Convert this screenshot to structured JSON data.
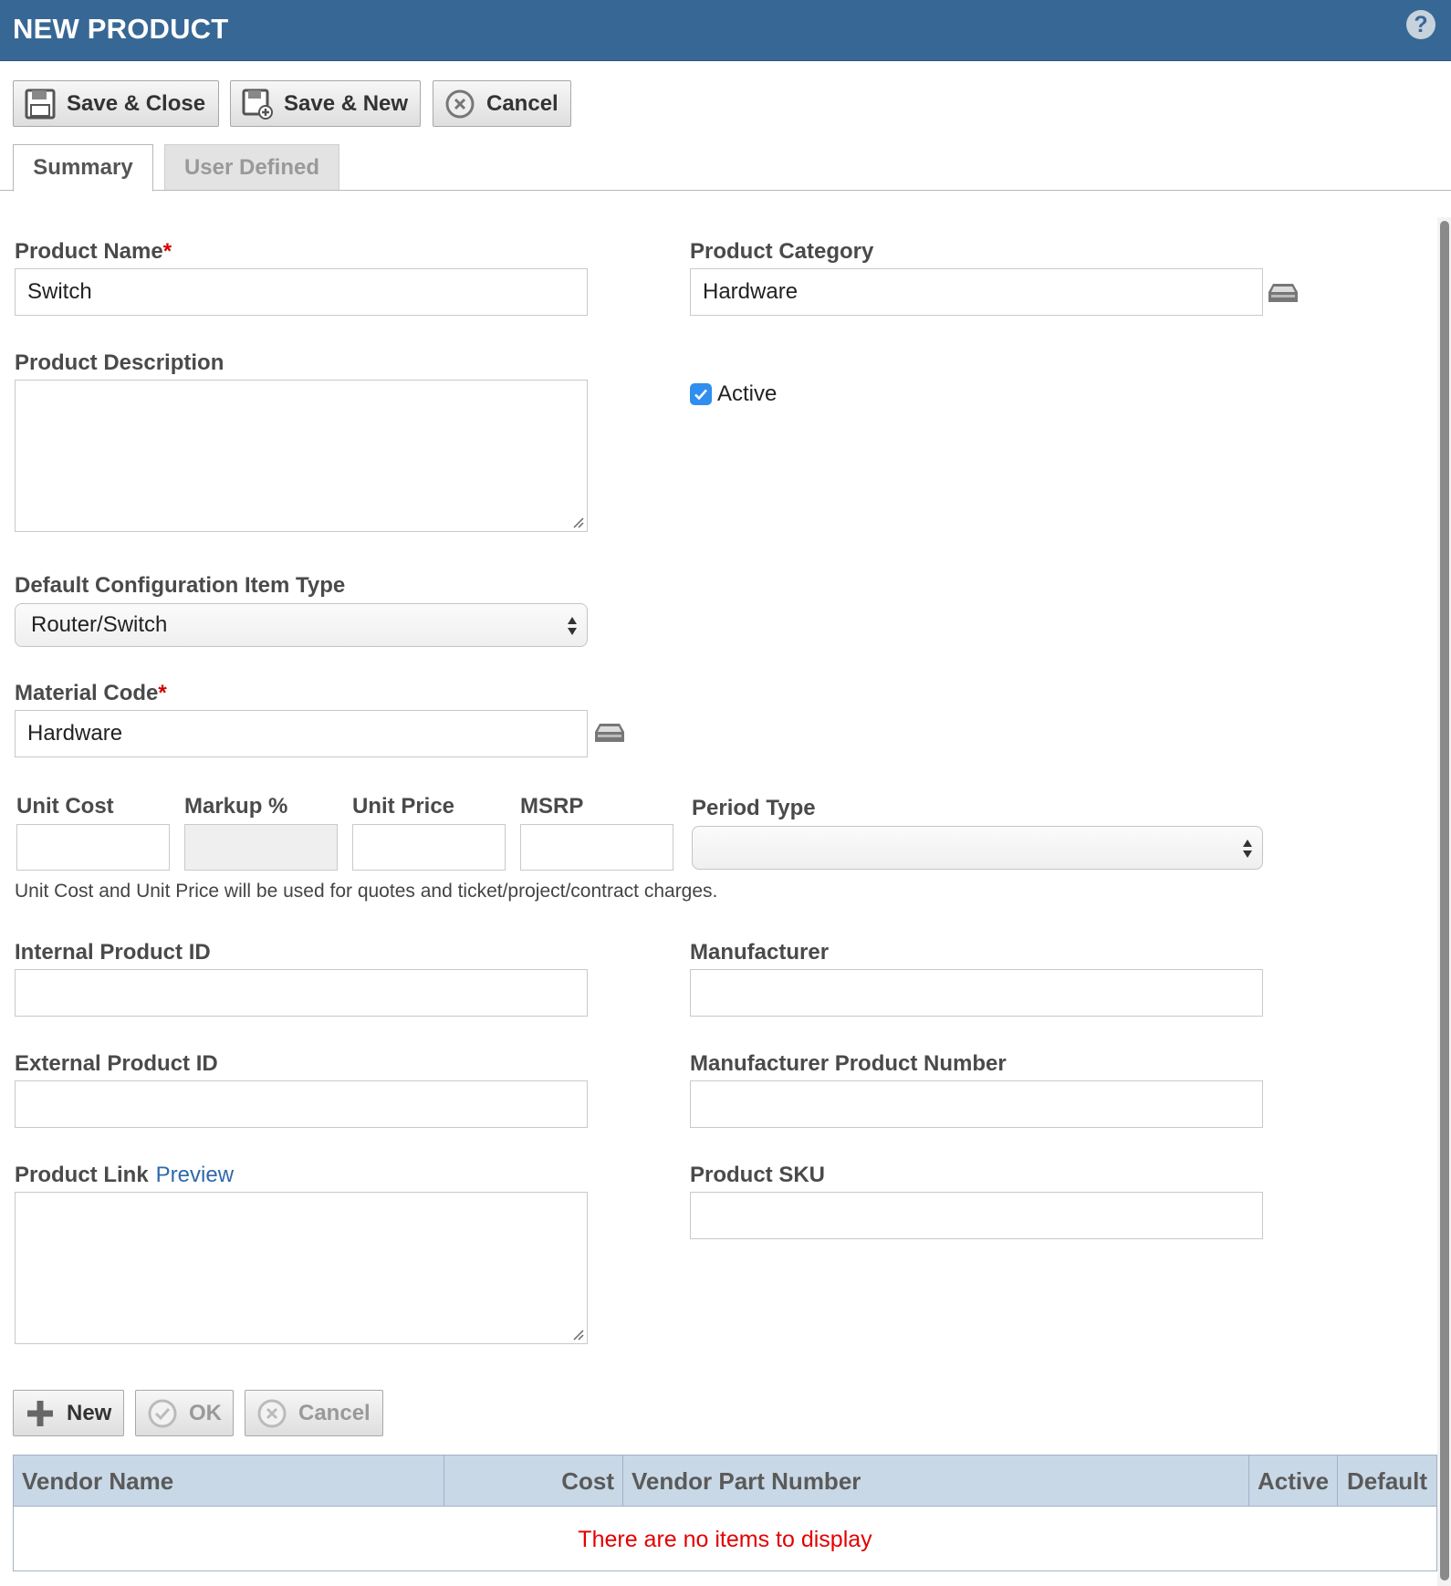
{
  "window": {
    "title": "NEW PRODUCT",
    "help_icon": "?"
  },
  "toolbar": {
    "save_close_label": "Save & Close",
    "save_new_label": "Save & New",
    "cancel_label": "Cancel"
  },
  "tabs": [
    {
      "label": "Summary",
      "active": true
    },
    {
      "label": "User Defined",
      "active": false
    }
  ],
  "form": {
    "product_name": {
      "label": "Product Name",
      "required": "*",
      "value": "Switch"
    },
    "product_category": {
      "label": "Product Category",
      "value": "Hardware"
    },
    "product_description": {
      "label": "Product Description",
      "value": ""
    },
    "active": {
      "label": "Active",
      "checked": true
    },
    "default_ci_type": {
      "label": "Default Configuration Item Type",
      "value": "Router/Switch"
    },
    "material_code": {
      "label": "Material Code",
      "required": "*",
      "value": "Hardware"
    },
    "unit_cost": {
      "label": "Unit Cost",
      "value": ""
    },
    "markup": {
      "label": "Markup %",
      "value": ""
    },
    "unit_price": {
      "label": "Unit Price",
      "value": ""
    },
    "msrp": {
      "label": "MSRP",
      "value": ""
    },
    "period_type": {
      "label": "Period Type",
      "value": ""
    },
    "pricing_hint": "Unit Cost and Unit Price will be used for quotes and ticket/project/contract charges.",
    "internal_product_id": {
      "label": "Internal Product ID",
      "value": ""
    },
    "manufacturer": {
      "label": "Manufacturer",
      "value": ""
    },
    "external_product_id": {
      "label": "External Product ID",
      "value": ""
    },
    "manufacturer_product_number": {
      "label": "Manufacturer Product Number",
      "value": ""
    },
    "product_link": {
      "label": "Product Link",
      "link_label": "Preview",
      "value": ""
    },
    "product_sku": {
      "label": "Product SKU",
      "value": ""
    }
  },
  "vendor_toolbar": {
    "new_label": "New",
    "ok_label": "OK",
    "cancel_label": "Cancel"
  },
  "vendor_grid": {
    "columns": [
      "Vendor Name",
      "Cost",
      "Vendor Part Number",
      "Active",
      "Default"
    ],
    "empty_message": "There are no items to display"
  },
  "colors": {
    "title_bar": "#376895",
    "required": "#d40000",
    "link": "#2f6aa8",
    "checkbox": "#2f8ef0",
    "grid_header": "#c9d8e6",
    "empty_message": "#e30000"
  },
  "icons": {
    "save_close": "floppy-disk-icon",
    "save_new": "floppy-disk-plus-icon",
    "cancel": "circle-x-icon",
    "lookup": "lookup-tray-icon",
    "new": "plus-icon",
    "ok": "circle-check-icon"
  }
}
